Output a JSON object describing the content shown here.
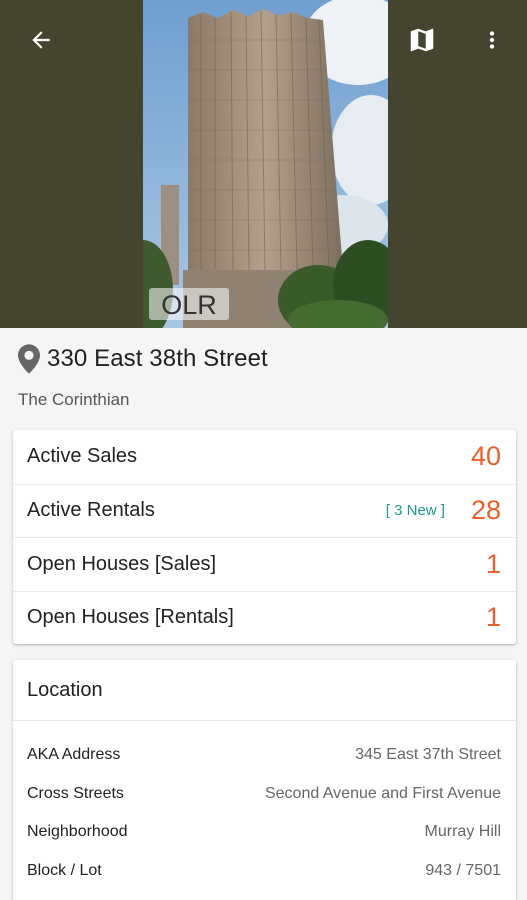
{
  "hero": {
    "photo_watermark": "OLR",
    "icons": [
      "arrow-back-icon",
      "map-icon",
      "more-vert-icon"
    ]
  },
  "building": {
    "address": "330 East 38th Street",
    "name": "The Corinthian"
  },
  "stats": [
    {
      "label": "Active Sales",
      "badge": "",
      "value": "40"
    },
    {
      "label": "Active Rentals",
      "badge": "[ 3 New ]",
      "value": "28"
    },
    {
      "label": "Open Houses [Sales]",
      "badge": "",
      "value": "1"
    },
    {
      "label": "Open Houses [Rentals]",
      "badge": "",
      "value": "1"
    }
  ],
  "location": {
    "header": "Location",
    "rows": [
      {
        "key": "AKA Address",
        "value": "345 East 37th Street"
      },
      {
        "key": "Cross Streets",
        "value": "Second Avenue and First Avenue"
      },
      {
        "key": "Neighborhood",
        "value": "Murray Hill"
      },
      {
        "key": "Block / Lot",
        "value": "943 / 7501"
      }
    ]
  },
  "colors": {
    "hero_bg": "#45452f",
    "accent_orange": "#e8602c",
    "badge_teal": "#1e9a8c"
  }
}
